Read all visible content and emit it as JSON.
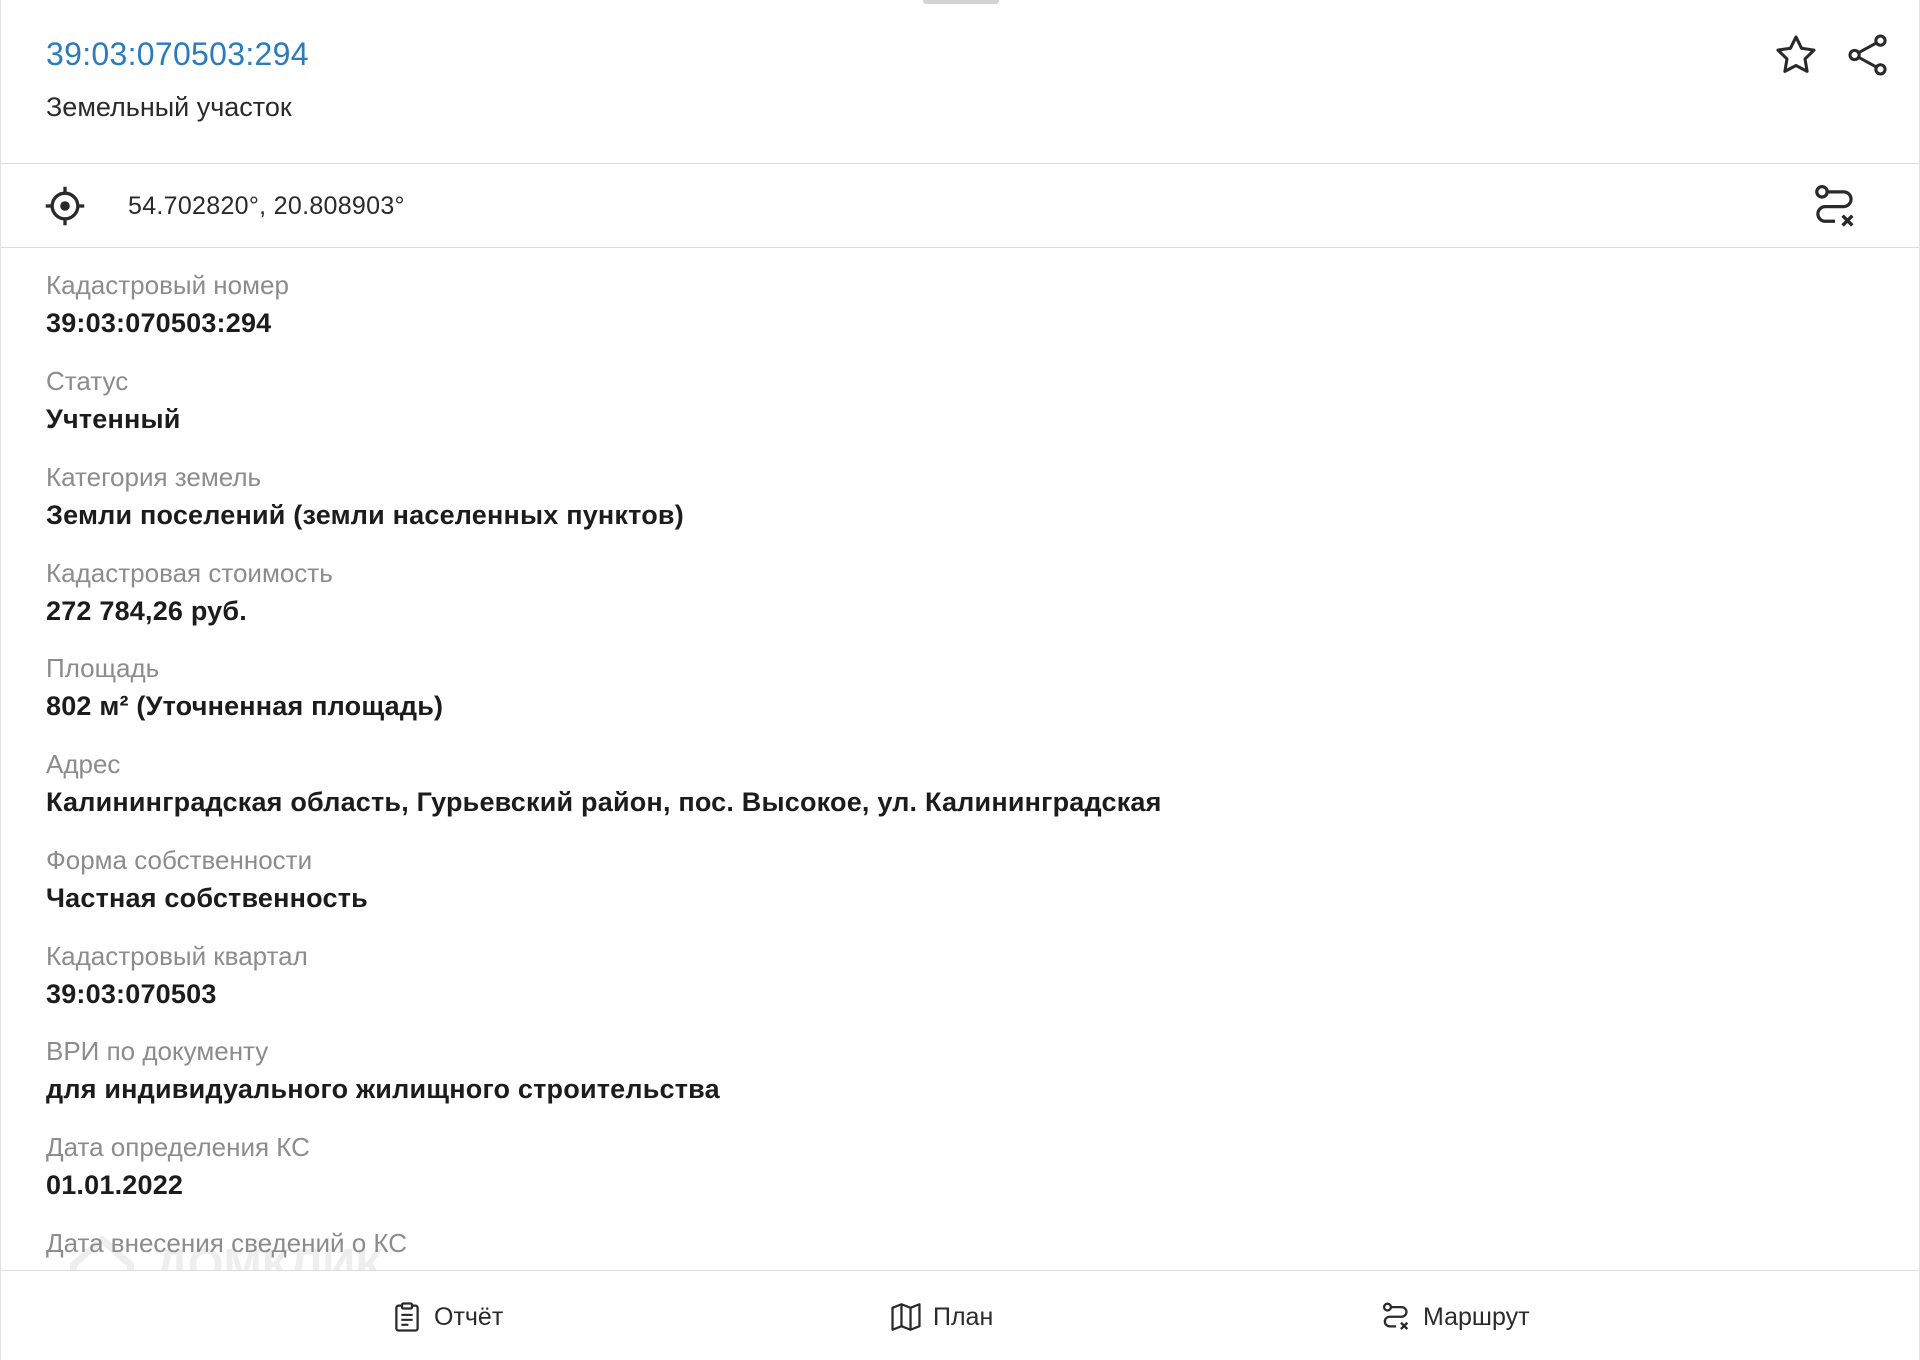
{
  "header": {
    "cadastral_number": "39:03:070503:294",
    "object_type": "Земельный участок",
    "favorite_icon": "star-icon",
    "share_icon": "share-icon"
  },
  "location": {
    "icon": "target-icon",
    "coordinates": "54.702820°, 20.808903°",
    "route_icon": "route-icon"
  },
  "fields": [
    {
      "label": "Кадастровый номер",
      "value": "39:03:070503:294"
    },
    {
      "label": "Статус",
      "value": "Учтенный"
    },
    {
      "label": "Категория земель",
      "value": "Земли поселений (земли населенных пунктов)"
    },
    {
      "label": "Кадастровая стоимость",
      "value": "272 784,26 руб."
    },
    {
      "label": "Площадь",
      "value": "802 м² (Уточненная площадь)"
    },
    {
      "label": "Адрес",
      "value": "Калининградская область, Гурьевский район, пос. Высокое, ул. Калининградская"
    },
    {
      "label": "Форма собственности",
      "value": "Частная собственность"
    },
    {
      "label": "Кадастровый квартал",
      "value": "39:03:070503"
    },
    {
      "label": "ВРИ по документу",
      "value": "для индивидуального жилищного строительства"
    },
    {
      "label": "Дата определения КС",
      "value": "01.01.2022"
    },
    {
      "label": "Дата внесения сведений о КС",
      "value": ""
    }
  ],
  "watermark": "ДОМКЛИК",
  "bottom_bar": {
    "report_label": "Отчёт",
    "plan_label": "План",
    "route_label": "Маршрут"
  },
  "colors": {
    "link": "#2b7bbd",
    "label": "#8c8c8c",
    "value": "#1c1c1c",
    "divider": "#dcdcdc"
  }
}
